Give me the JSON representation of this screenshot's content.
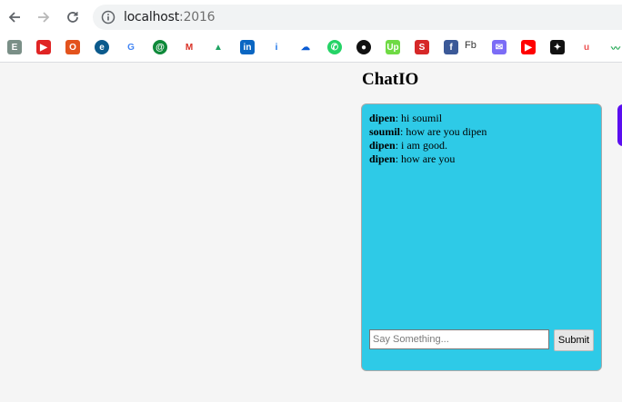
{
  "browser": {
    "url_host": "localhost",
    "url_port": ":2016",
    "bookmarks": [
      {
        "icon": "evernote-icon",
        "color": "#7a8f87",
        "glyph": "E"
      },
      {
        "icon": "red-play-icon",
        "color": "#e02424",
        "glyph": "▶"
      },
      {
        "icon": "office-icon",
        "color": "#e3531d",
        "glyph": "O"
      },
      {
        "icon": "e-circle-icon",
        "color": "#0b5a8c",
        "glyph": "e"
      },
      {
        "icon": "google-icon",
        "color": "#ffffff",
        "glyph": "G"
      },
      {
        "icon": "green-swirl-icon",
        "color": "#0f8a3a",
        "glyph": "@"
      },
      {
        "icon": "gmail-icon",
        "color": "#ffffff",
        "glyph": "M"
      },
      {
        "icon": "google-drive-icon",
        "color": "#ffffff",
        "glyph": "▲"
      },
      {
        "icon": "linkedin-icon",
        "color": "#0a66c2",
        "glyph": "in"
      },
      {
        "icon": "info-i-icon",
        "color": "#ffffff",
        "glyph": "i"
      },
      {
        "icon": "onedrive-icon",
        "color": "#ffffff",
        "glyph": "☁"
      },
      {
        "icon": "whatsapp-icon",
        "color": "#25d366",
        "glyph": "✆"
      },
      {
        "icon": "github-icon",
        "color": "#111111",
        "glyph": "●"
      },
      {
        "icon": "upwork-icon",
        "color": "#6fda44",
        "glyph": "Up"
      },
      {
        "icon": "red-s-icon",
        "color": "#d62828",
        "glyph": "S"
      },
      {
        "icon": "facebook-icon",
        "color": "#3b5998",
        "glyph": "f"
      },
      {
        "icon": "mail-icon",
        "color": "#7b6cf6",
        "glyph": "✉"
      },
      {
        "icon": "youtube-icon",
        "color": "#ff0000",
        "glyph": "▶"
      },
      {
        "icon": "black-logo-icon",
        "color": "#111111",
        "glyph": "✦"
      },
      {
        "icon": "udemy-icon",
        "color": "#ffffff",
        "glyph": "u"
      },
      {
        "icon": "green-wave-icon",
        "color": "#ffffff",
        "glyph": "〰"
      }
    ],
    "fb_label": "Fb"
  },
  "page": {
    "title": "ChatIO",
    "messages": [
      {
        "user": "dipen",
        "text": ": hi soumil"
      },
      {
        "user": "soumil",
        "text": ": how are you dipen"
      },
      {
        "user": "dipen",
        "text": ": i am good."
      },
      {
        "user": "dipen",
        "text": ": how are you"
      }
    ],
    "input_placeholder": "Say Something...",
    "input_value": "",
    "submit_label": "Submit"
  },
  "colors": {
    "chat_background": "#2ecae7",
    "side_tab": "#5b0ef0"
  }
}
